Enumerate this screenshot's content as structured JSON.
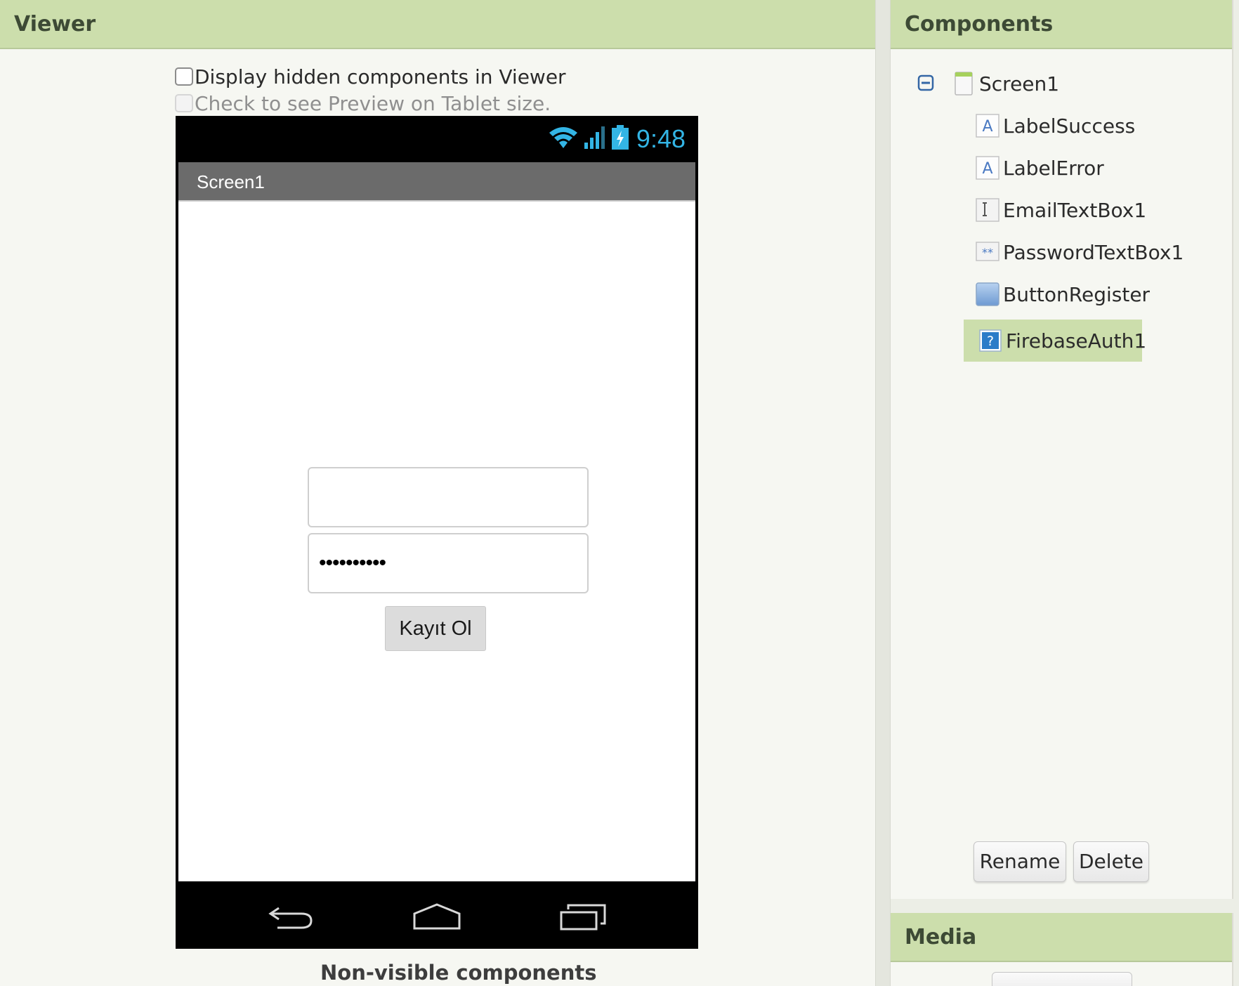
{
  "viewer": {
    "title": "Viewer",
    "display_hidden_label": "Display hidden components in Viewer",
    "tablet_preview_label": "Check to see Preview on Tablet size.",
    "nonvisible_label": "Non-visible components"
  },
  "phone": {
    "status_time": "9:48",
    "screen_title": "Screen1",
    "email_value": "",
    "password_value": "••••••••••",
    "register_button_label": "Kayıt Ol"
  },
  "components": {
    "title": "Components",
    "root": {
      "label": "Screen1",
      "icon": "screen-icon"
    },
    "items": [
      {
        "label": "LabelSuccess",
        "icon": "label-icon"
      },
      {
        "label": "LabelError",
        "icon": "label-icon"
      },
      {
        "label": "EmailTextBox1",
        "icon": "textbox-icon"
      },
      {
        "label": "PasswordTextBox1",
        "icon": "password-textbox-icon"
      },
      {
        "label": "ButtonRegister",
        "icon": "button-icon"
      },
      {
        "label": "FirebaseAuth1",
        "icon": "extension-icon",
        "selected": true
      }
    ],
    "rename_label": "Rename",
    "delete_label": "Delete"
  },
  "media": {
    "title": "Media"
  },
  "colors": {
    "header_bg": "#ccdeac",
    "panel_bg": "#f6f7f2",
    "status_accent": "#33b5e5",
    "selected_bg": "#ccdeac"
  }
}
